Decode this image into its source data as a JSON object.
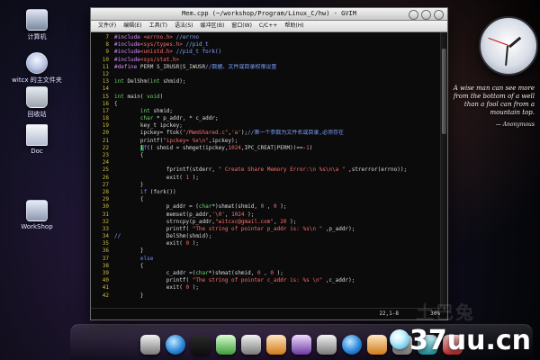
{
  "desktop": {
    "icons": [
      {
        "label": "计算机",
        "icon": "computer-icon"
      },
      {
        "label": "witcx 的主文件夹",
        "icon": "home-folder-icon"
      },
      {
        "label": "回收站",
        "icon": "trash-icon"
      },
      {
        "label": "Doc",
        "icon": "document-icon"
      },
      {
        "label": "WorkShop",
        "icon": "workshop-folder-icon"
      }
    ],
    "quote": {
      "text": "A wise man can see more from the bottom of a well than a fool can from a mountain top.",
      "author": "— Anonymous"
    }
  },
  "window": {
    "title": "Mem.cpp (~/workshop/Program/Linux_C/hw) - GVIM",
    "menus": [
      "文件(F)",
      "编辑(E)",
      "工具(T)",
      "语法(S)",
      "缓冲区(B)",
      "窗口(W)",
      "C/C++",
      "帮助(H)"
    ],
    "status": {
      "position": "22,1-8",
      "percent": "30%"
    }
  },
  "code": {
    "lines": [
      {
        "n": "7",
        "html": "<span class='pre'>#include</span> <span class='str'>&lt;errno.h&gt;</span> <span class='cmt'>//errno</span>"
      },
      {
        "n": "8",
        "html": "<span class='pre'>#include</span><span class='str'>&lt;sys/types.h&gt;</span> <span class='cmt'>//pid_t</span>"
      },
      {
        "n": "9",
        "html": "<span class='pre'>#include</span><span class='str'>&lt;unistd.h&gt;</span> <span class='cmt'>//pid_t fork()</span>"
      },
      {
        "n": "10",
        "html": "<span class='pre'>#include</span><span class='str'>&lt;sys/stat.h&gt;</span>"
      },
      {
        "n": "11",
        "html": "<span class='pre'>#define</span> PERM S_IRUSR|S_IWUSR<span class='cmt'>//数据、文件或目录权限设置</span>"
      },
      {
        "n": "12",
        "html": ""
      },
      {
        "n": "13",
        "html": "<span class='ty'>int</span> DelShm(<span class='ty'>int</span> shmid);"
      },
      {
        "n": "14",
        "html": ""
      },
      {
        "n": "15",
        "html": "<span class='ty'>int</span> main( <span class='ty'>void</span>)"
      },
      {
        "n": "16",
        "html": "{"
      },
      {
        "n": "17",
        "html": "        <span class='ty'>int</span> shmid;"
      },
      {
        "n": "18",
        "html": "        <span class='ty'>char</span> * p_addr, * c_addr;"
      },
      {
        "n": "19",
        "html": "        key_t ipckey;"
      },
      {
        "n": "20",
        "html": "        ipckey= ftok(<span class='str'>\"/MemShared.c\"</span>,<span class='str'>'a'</span>);<span class='cmt'>//第一个参数为文件名或目录,必须存在</span>"
      },
      {
        "n": "21",
        "html": "        printf(<span class='str'>\"ipckey= %x\\n\"</span>,ipckey);"
      },
      {
        "n": "22",
        "html": "        <span class='cursor-hl'>i</span><span class='kw'>f</span>(( shmid = shmget(ipckey,<span class='num'>1024</span>,IPC_CREAT|PERM))==-<span class='num'>1</span>)"
      },
      {
        "n": "23",
        "html": "        {"
      },
      {
        "n": "24",
        "html": ""
      },
      {
        "n": "25",
        "html": "                fprintf(stderr, <span class='str'>\" Create Share Memory Error:\\n %s\\n\\a \"</span> ,strerror(errno));"
      },
      {
        "n": "26",
        "html": "                exit( <span class='num'>1</span> );"
      },
      {
        "n": "27",
        "html": "        }"
      },
      {
        "n": "28",
        "html": "        <span class='kw'>if</span> (fork())"
      },
      {
        "n": "29",
        "html": "        {"
      },
      {
        "n": "30",
        "html": "                p_addr = (<span class='ty'>char</span>*)shmat(shmid, <span class='num'>0</span> , <span class='num'>0</span> );"
      },
      {
        "n": "31",
        "html": "                memset(p_addr,<span class='str'>'\\0'</span>, <span class='num'>1024</span> );"
      },
      {
        "n": "32",
        "html": "                strncpy(p_addr,<span class='str'>\"witcxc@gmail.com\"</span>, <span class='num'>20</span> );"
      },
      {
        "n": "33",
        "html": "                printf( <span class='str'>\"The string of pointer p_addr is: %s\\n \"</span> ,p_addr);"
      },
      {
        "n": "34",
        "html": "<span class='cmt'>//</span>              DelShm(shmid);"
      },
      {
        "n": "35",
        "html": "                exit( <span class='num'>0</span> );"
      },
      {
        "n": "36",
        "html": "        }"
      },
      {
        "n": "37",
        "html": "        <span class='kw'>else</span>"
      },
      {
        "n": "38",
        "html": "        {"
      },
      {
        "n": "39",
        "html": "                c_addr =(<span class='ty'>char</span>*)shmat(shmid, <span class='num'>0</span> , <span class='num'>0</span> );"
      },
      {
        "n": "40",
        "html": "                printf( <span class='str'>\"The string of pointer c_addr is: %s \\n\"</span> ,c_addr);"
      },
      {
        "n": "41",
        "html": "                exit( <span class='num'>0</span> );"
      },
      {
        "n": "42",
        "html": "        }"
      }
    ]
  },
  "watermark": {
    "sub": "土巴兔",
    "main": "37uu.cn"
  }
}
